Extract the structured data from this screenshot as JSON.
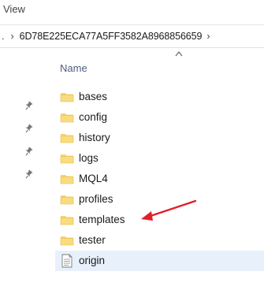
{
  "ribbon": {
    "view_tab": "View"
  },
  "address": {
    "lead": ".",
    "path": "6D78E225ECA77A5FF3582A8968856659"
  },
  "columns": {
    "name_header": "Name"
  },
  "items": [
    {
      "label": "bases",
      "icon": "folder-icon"
    },
    {
      "label": "config",
      "icon": "folder-icon"
    },
    {
      "label": "history",
      "icon": "folder-icon"
    },
    {
      "label": "logs",
      "icon": "folder-icon"
    },
    {
      "label": "MQL4",
      "icon": "folder-icon"
    },
    {
      "label": "profiles",
      "icon": "folder-icon"
    },
    {
      "label": "templates",
      "icon": "folder-icon"
    },
    {
      "label": "tester",
      "icon": "folder-icon"
    },
    {
      "label": "origin",
      "icon": "text-file-icon"
    }
  ],
  "annotation": {
    "color": "#e0202a",
    "target": "templates"
  },
  "colors": {
    "folder": "#f7d36b",
    "folder_dark": "#e6b94a",
    "highlight": "#e8f1fb"
  }
}
